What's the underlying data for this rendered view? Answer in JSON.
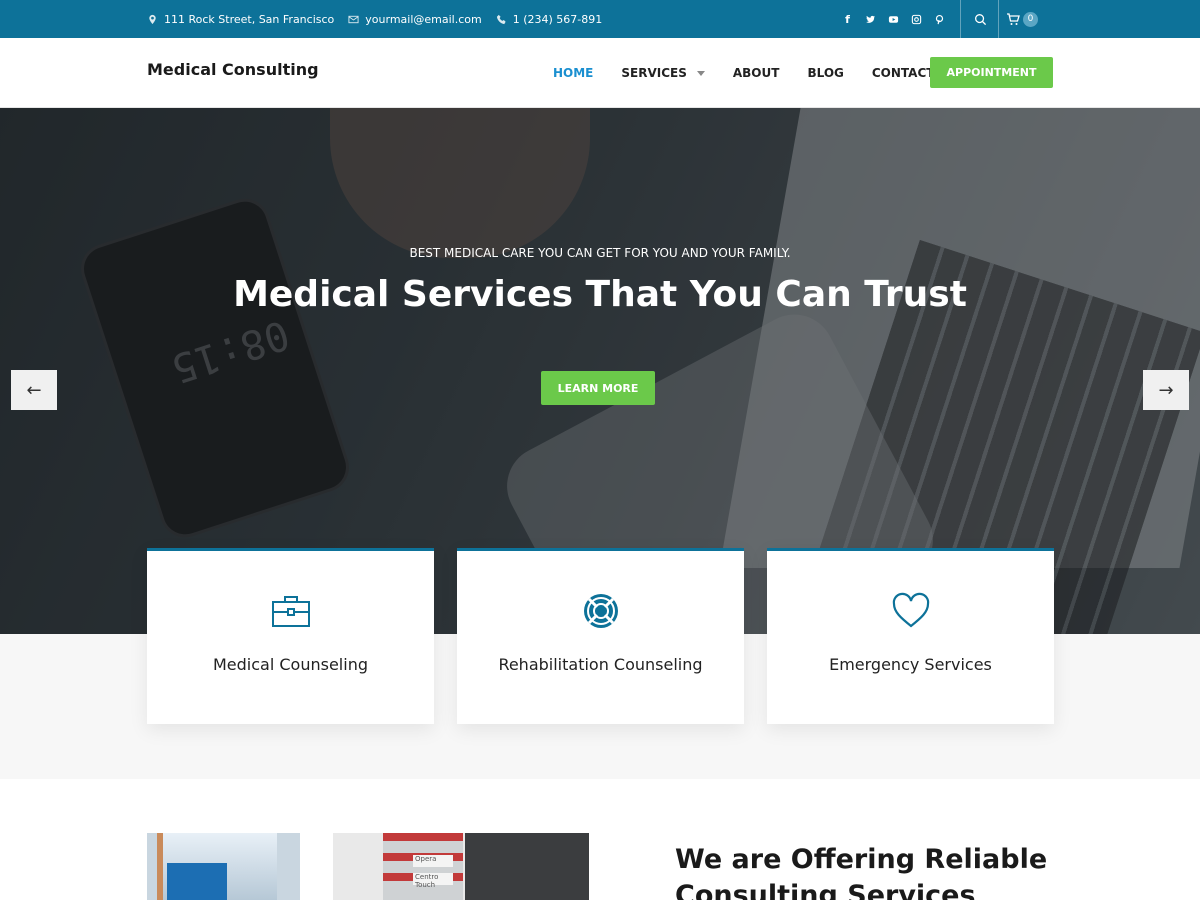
{
  "topbar": {
    "address": "111 Rock Street, San Francisco",
    "email": "yourmail@email.com",
    "phone": "1 (234) 567-891",
    "social": [
      "facebook-icon",
      "twitter-icon",
      "youtube-icon",
      "instagram-icon",
      "pinterest-icon"
    ],
    "cart_count": "0"
  },
  "header": {
    "logo": "Medical Consulting",
    "nav": [
      {
        "label": "HOME",
        "active": true
      },
      {
        "label": "SERVICES",
        "dropdown": true
      },
      {
        "label": "ABOUT"
      },
      {
        "label": "BLOG"
      },
      {
        "label": "CONTACT"
      }
    ],
    "appointment": "APPOINTMENT"
  },
  "hero": {
    "subtitle": "BEST MEDICAL CARE YOU CAN GET FOR YOU AND YOUR FAMILY.",
    "title": "Medical Services That You Can Trust",
    "button": "LEARN MORE",
    "phone_time": "08:15",
    "prev_arrow": "←",
    "next_arrow": "→"
  },
  "features": [
    {
      "label": "Medical Counseling",
      "icon": "briefcase-icon"
    },
    {
      "label": "Rehabilitation Counseling",
      "icon": "lifebuoy-icon"
    },
    {
      "label": "Emergency Services",
      "icon": "heart-icon"
    }
  ],
  "about": {
    "title": "We are Offering Reliable Consulting Services",
    "rack_labels": [
      "Opera",
      "Centro Touch"
    ]
  },
  "colors": {
    "topbar": "#0d7299",
    "accent_green": "#6bc94a",
    "nav_active": "#1a8fd0",
    "icon_teal": "#0d7299"
  }
}
